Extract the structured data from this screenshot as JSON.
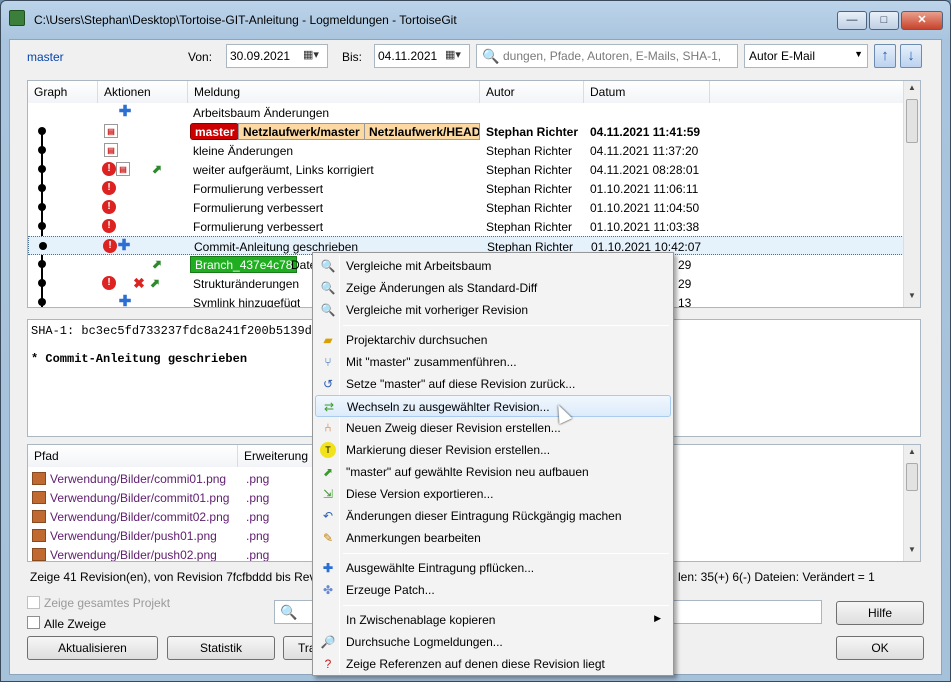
{
  "window": {
    "title": "C:\\Users\\Stephan\\Desktop\\Tortoise-GIT-Anleitung - Logmeldungen - TortoiseGit",
    "min": "—",
    "max": "□",
    "close": "✕"
  },
  "toolbar": {
    "branch": "master",
    "from_label": "Von:",
    "from_value": "30.09.2021",
    "to_label": "Bis:",
    "to_value": "04.11.2021",
    "search_placeholder": "dungen, Pfade, Autoren, E-Mails, SHA-1,",
    "filter_combo": "Autor E-Mail"
  },
  "log": {
    "headers": [
      "Graph",
      "Aktionen",
      "Meldung",
      "Autor",
      "Datum"
    ],
    "rows": [
      {
        "msg": "Arbeitsbaum Änderungen",
        "author": "",
        "date": ""
      },
      {
        "msg": "",
        "badges": [
          "master",
          "Netzlaufwerk/master",
          "Netzlaufwerk/HEAD"
        ],
        "author": "Stephan Richter",
        "date": "04.11.2021 11:41:59"
      },
      {
        "msg": "kleine Änderungen",
        "author": "Stephan Richter",
        "date": "04.11.2021 11:37:20"
      },
      {
        "msg": "weiter aufgeräumt, Links korrigiert",
        "author": "Stephan Richter",
        "date": "04.11.2021 08:28:01"
      },
      {
        "msg": "Formulierung verbessert",
        "author": "Stephan Richter",
        "date": "01.10.2021 11:06:11"
      },
      {
        "msg": "Formulierung verbessert",
        "author": "Stephan Richter",
        "date": "01.10.2021 11:04:50"
      },
      {
        "msg": "Formulierung verbessert",
        "author": "Stephan Richter",
        "date": "01.10.2021 11:03:38"
      },
      {
        "msg": "Commit-Anleitung geschrieben",
        "author": "Stephan Richter",
        "date": "01.10.2021 10:42:07"
      },
      {
        "msg": "Date",
        "badges": [
          "Branch_437e4c78"
        ],
        "author": "",
        "date": "29"
      },
      {
        "msg": "Strukturänderungen",
        "author": "",
        "date": "29"
      },
      {
        "msg": "Symlink hinzugefügt",
        "author": "",
        "date": "13"
      }
    ]
  },
  "details": {
    "sha": "SHA-1: bc3ec5fd733237fdc8a241f200b5139d2e",
    "message": "* Commit-Anleitung geschrieben"
  },
  "files": {
    "headers": [
      "Pfad",
      "Erweiterung"
    ],
    "rows": [
      {
        "path": "Verwendung/Bilder/commi01.png",
        "ext": ".png"
      },
      {
        "path": "Verwendung/Bilder/commit01.png",
        "ext": ".png"
      },
      {
        "path": "Verwendung/Bilder/commit02.png",
        "ext": ".png"
      },
      {
        "path": "Verwendung/Bilder/push01.png",
        "ext": ".png"
      },
      {
        "path": "Verwendung/Bilder/push02.png",
        "ext": ".png"
      }
    ]
  },
  "status": {
    "left": "Zeige 41 Revision(en), von Revision 7fcfbddd bis Revis",
    "right": "len: 35(+) 6(-) Dateien: Verändert = 1"
  },
  "bottom": {
    "show_whole_project": "Zeige gesamtes Projekt",
    "all_branches": "Alle Zweige",
    "refresh": "Aktualisieren",
    "statistics": "Statistik",
    "third": "Tra",
    "help": "Hilfe",
    "ok": "OK"
  },
  "context_menu": {
    "items": [
      {
        "label": "Vergleiche mit Arbeitsbaum",
        "icon": "compare-icon"
      },
      {
        "label": "Zeige Änderungen als Standard-Diff",
        "icon": "diff-icon"
      },
      {
        "label": "Vergleiche mit vorheriger Revision",
        "icon": "compare-prev-icon"
      },
      {
        "label": "Projektarchiv durchsuchen",
        "icon": "repo-browser-icon"
      },
      {
        "label": "Mit \"master\" zusammenführen...",
        "icon": "merge-icon"
      },
      {
        "label": "Setze \"master\" auf diese Revision zurück...",
        "icon": "reset-icon"
      },
      {
        "label": "Wechseln zu ausgewählter Revision...",
        "icon": "switch-icon"
      },
      {
        "label": "Neuen Zweig dieser Revision erstellen...",
        "icon": "branch-icon"
      },
      {
        "label": "Markierung dieser Revision erstellen...",
        "icon": "tag-icon"
      },
      {
        "label": "\"master\" auf gewählte Revision neu aufbauen",
        "icon": "rebase-icon"
      },
      {
        "label": "Diese Version exportieren...",
        "icon": "export-icon"
      },
      {
        "label": "Änderungen dieser Eintragung Rückgängig machen",
        "icon": "revert-icon"
      },
      {
        "label": "Anmerkungen bearbeiten",
        "icon": "notes-icon"
      },
      {
        "label": "Ausgewählte Eintragung pflücken...",
        "icon": "cherry-pick-icon"
      },
      {
        "label": "Erzeuge Patch...",
        "icon": "patch-icon"
      },
      {
        "label": "In Zwischenablage kopieren",
        "icon": ""
      },
      {
        "label": "Durchsuche Logmeldungen...",
        "icon": "search-log-icon"
      },
      {
        "label": "Zeige Referenzen auf denen diese Revision liegt",
        "icon": "refs-icon"
      }
    ]
  }
}
